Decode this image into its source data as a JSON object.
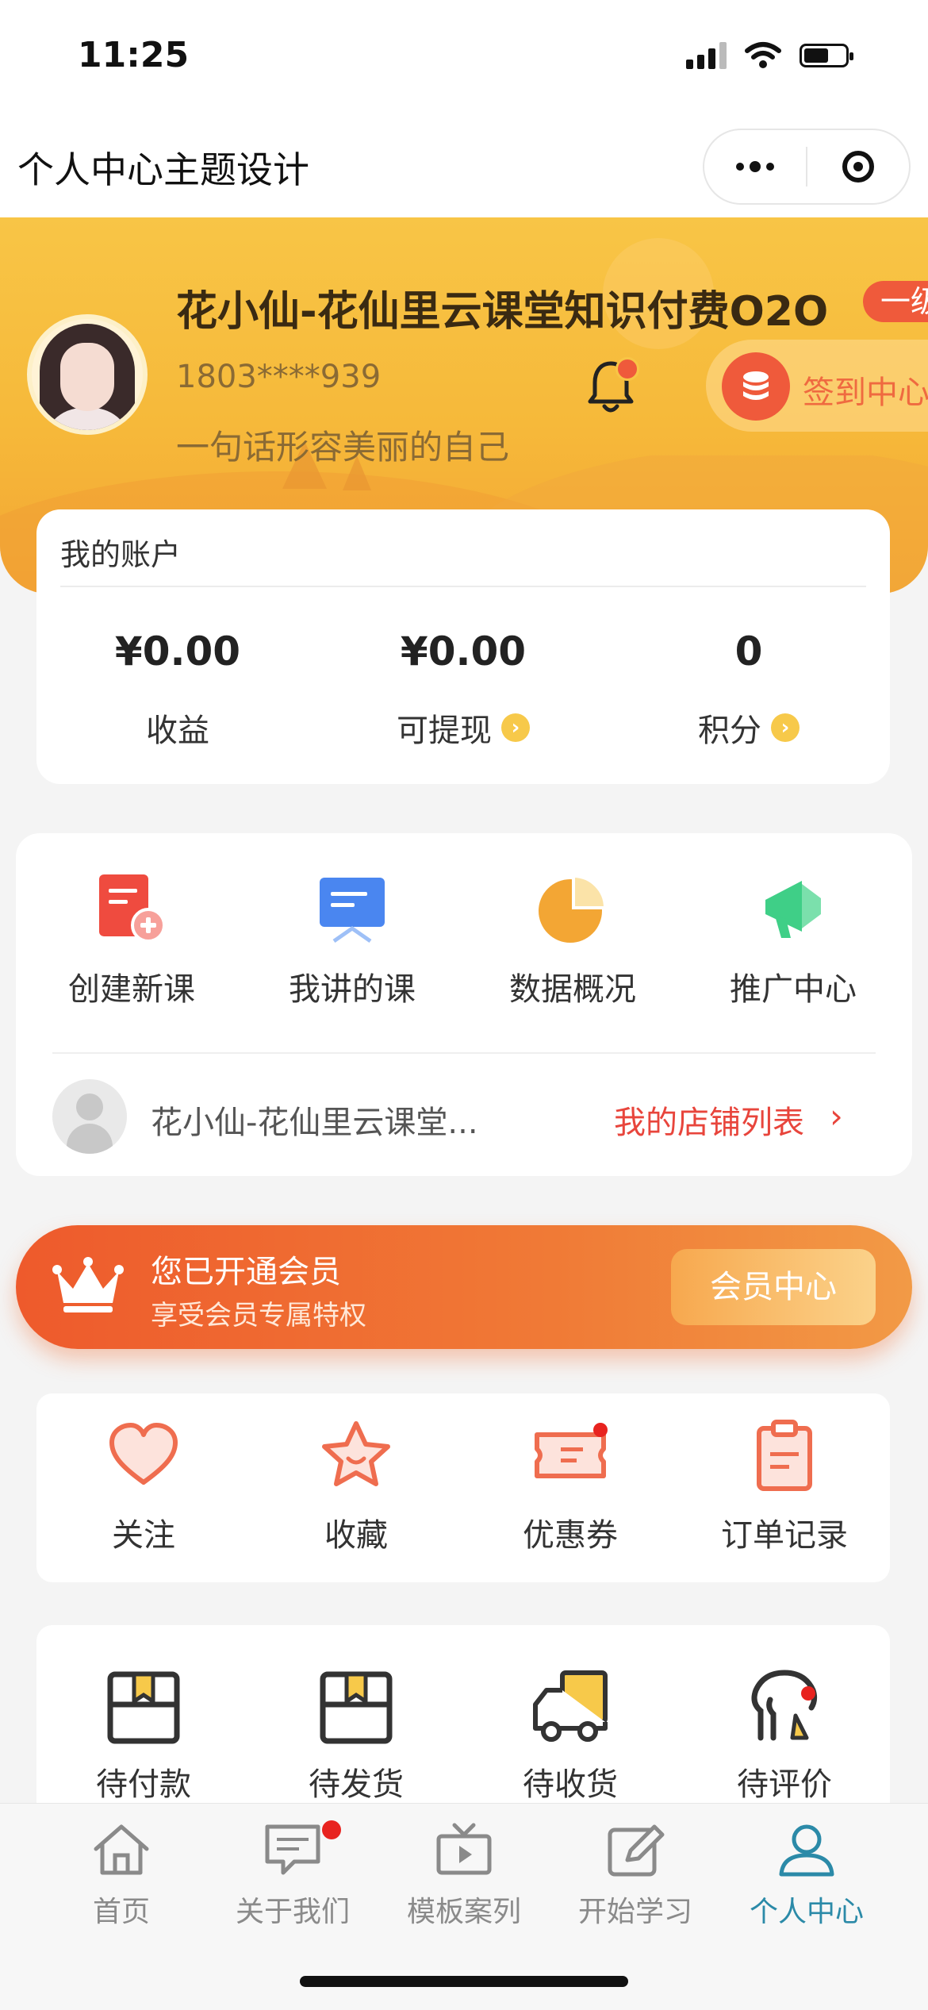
{
  "status_bar": {
    "time": "11:25"
  },
  "app": {
    "title": "个人中心主题设计"
  },
  "profile": {
    "name": "花小仙-花仙里云课堂知识付费O2O",
    "level": "一级",
    "phone": "1803****939",
    "motto": "一句话形容美丽的自己",
    "signin_label": "签到中心"
  },
  "account": {
    "title": "我的账户",
    "items": [
      {
        "value": "¥0.00",
        "label": "收益"
      },
      {
        "value": "¥0.00",
        "label": "可提现"
      },
      {
        "value": "0",
        "label": "积分"
      }
    ]
  },
  "teacher": {
    "items": [
      {
        "label": "创建新课",
        "icon": "create-course-icon"
      },
      {
        "label": "我讲的课",
        "icon": "my-courses-icon"
      },
      {
        "label": "数据概况",
        "icon": "data-overview-icon"
      },
      {
        "label": "推广中心",
        "icon": "promotion-icon"
      }
    ],
    "shop_name": "花小仙-花仙里云课堂...",
    "shop_link": "我的店铺列表"
  },
  "vip": {
    "title": "您已开通会员",
    "subtitle": "享受会员专属特权",
    "button": "会员中心"
  },
  "favorites": [
    {
      "label": "关注",
      "icon": "heart-icon"
    },
    {
      "label": "收藏",
      "icon": "star-icon"
    },
    {
      "label": "优惠券",
      "icon": "coupon-icon"
    },
    {
      "label": "订单记录",
      "icon": "clipboard-icon"
    }
  ],
  "orders": [
    {
      "label": "待付款",
      "icon": "pending-payment-icon"
    },
    {
      "label": "待发货",
      "icon": "pending-shipment-icon"
    },
    {
      "label": "待收货",
      "icon": "delivery-truck-icon"
    },
    {
      "label": "待评价",
      "icon": "review-icon"
    }
  ],
  "tabbar": [
    {
      "label": "首页",
      "icon": "home-icon"
    },
    {
      "label": "关于我们",
      "icon": "message-icon"
    },
    {
      "label": "模板案列",
      "icon": "tv-icon"
    },
    {
      "label": "开始学习",
      "icon": "edit-icon"
    },
    {
      "label": "个人中心",
      "icon": "user-icon",
      "active": true
    }
  ],
  "colors": {
    "accent_red": "#ef5a3b",
    "banner_yellow": "#f8c546",
    "active_tab": "#2b8aa8"
  }
}
